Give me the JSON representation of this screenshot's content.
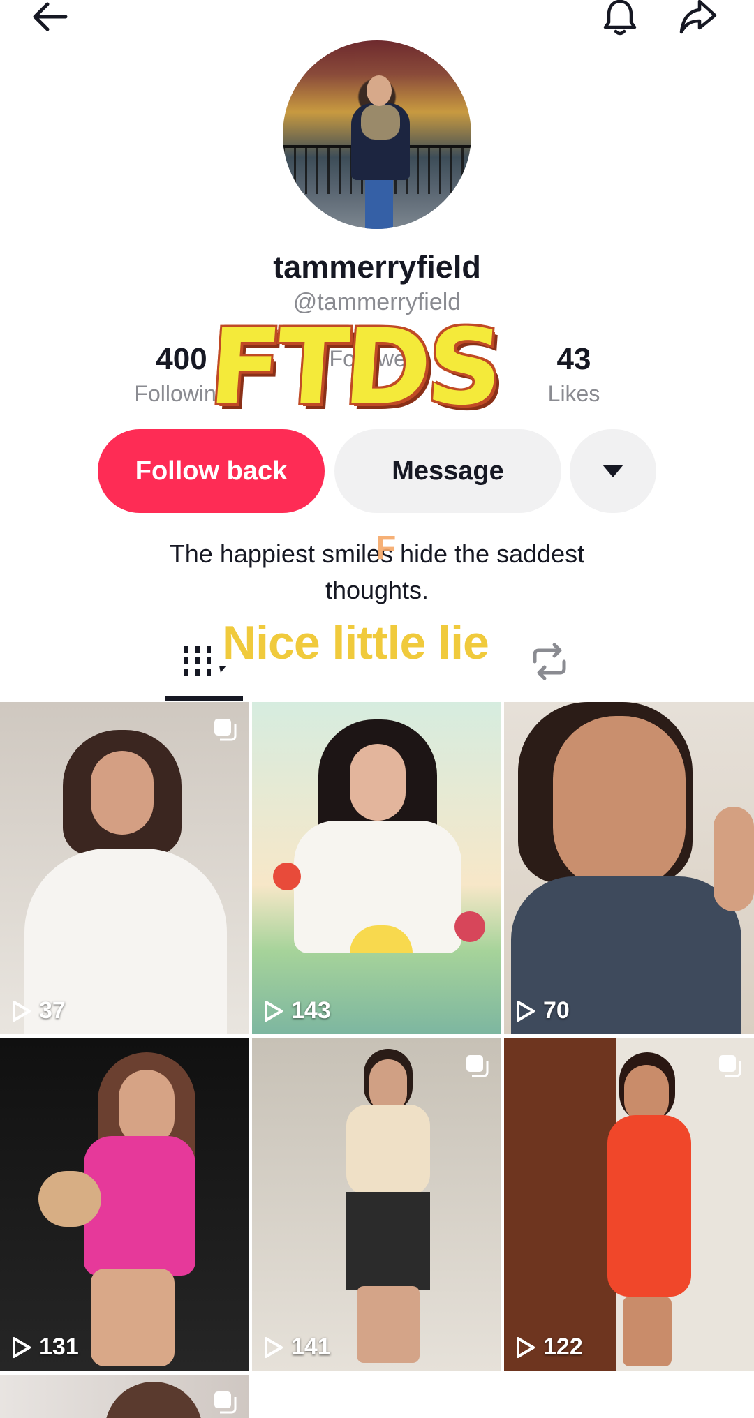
{
  "profile": {
    "display_name": "tammerryfield",
    "handle": "@tammerryfield",
    "bio_line1": "The happiest smiles hide the saddest",
    "bio_line2": "thoughts."
  },
  "stats": {
    "following_count": "400",
    "following_label": "Following",
    "followers_count": "",
    "followers_label": "Followers",
    "likes_count": "43",
    "likes_label": "Likes"
  },
  "buttons": {
    "follow_back": "Follow back",
    "message": "Message"
  },
  "overlays": {
    "big_text": "FTDS",
    "small_letter": "F",
    "caption": "Nice little lie"
  },
  "videos": [
    {
      "views": "37",
      "colors": [
        "#d9d4cf",
        "#f3f1ee"
      ]
    },
    {
      "views": "143",
      "colors": [
        "#a9d8c0",
        "#f2d6a8"
      ]
    },
    {
      "views": "70",
      "colors": [
        "#e8e1d8",
        "#3e4a5a"
      ]
    },
    {
      "views": "131",
      "colors": [
        "#1a1a1a",
        "#e5449a"
      ]
    },
    {
      "views": "141",
      "colors": [
        "#c9c3b8",
        "#2b2b2b"
      ]
    },
    {
      "views": "122",
      "colors": [
        "#7a3e26",
        "#f0472a"
      ]
    },
    {
      "views": "",
      "colors": [
        "#d8d2ce",
        "#5a3a2e"
      ]
    }
  ],
  "icons": [
    "back-arrow-icon",
    "bell-icon",
    "share-icon",
    "videos-grid-icon",
    "repost-icon",
    "play-icon",
    "multi-image-icon"
  ]
}
